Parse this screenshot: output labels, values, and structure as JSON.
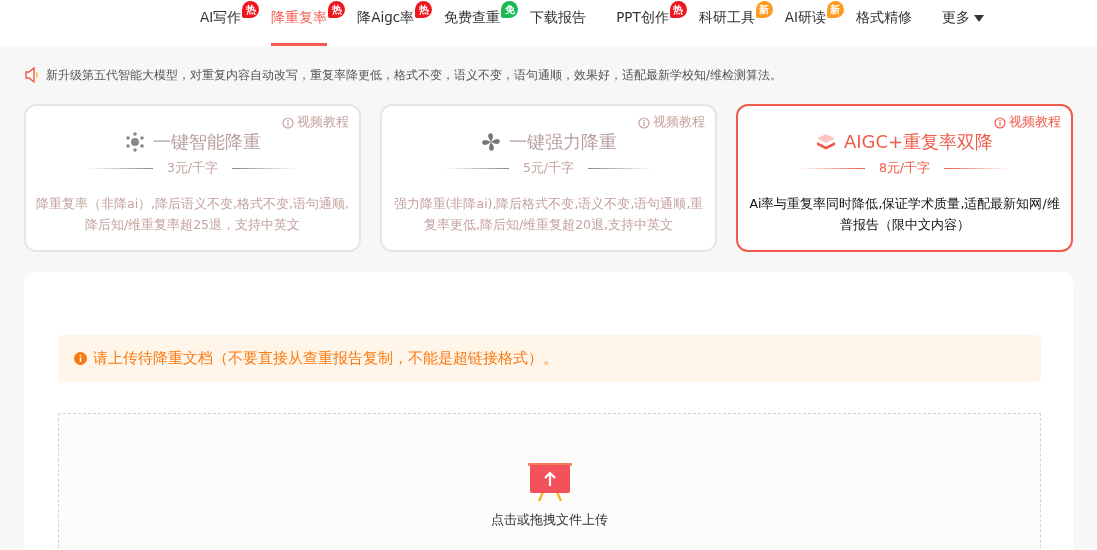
{
  "nav": [
    {
      "label": "AI写作",
      "selected": false,
      "badge": {
        "text": "热",
        "kind": "hot"
      }
    },
    {
      "label": "降重复率",
      "selected": true,
      "badge": {
        "text": "热",
        "kind": "hot"
      }
    },
    {
      "label": "降Aigc率",
      "selected": false,
      "badge": {
        "text": "热",
        "kind": "hot"
      }
    },
    {
      "label": "免费查重",
      "selected": false,
      "badge": {
        "text": "免",
        "kind": "free"
      }
    },
    {
      "label": "下载报告",
      "selected": false
    },
    {
      "label": "PPT创作",
      "selected": false,
      "badge": {
        "text": "热",
        "kind": "hot"
      }
    },
    {
      "label": "科研工具",
      "selected": false,
      "badge": {
        "text": "新",
        "kind": "new"
      }
    },
    {
      "label": "AI研读",
      "selected": false,
      "badge": {
        "text": "新",
        "kind": "new"
      }
    },
    {
      "label": "格式精修",
      "selected": false
    },
    {
      "label": "更多",
      "selected": false,
      "dropdown": true
    }
  ],
  "notice": "新升级第五代智能大模型，对重复内容自动改写，重复率降更低，格式不变，语义不变，语句通顺，效果好，适配最新学校知/维检测算法。",
  "plans": [
    {
      "title": "一键智能降重",
      "price": "3元/千字",
      "tutorial": "视频教程",
      "description": "降重复率（非降ai）,降后语义不变,格式不变,语句通顺,降后知/维重复率超25退，支持中英文",
      "selected": false
    },
    {
      "title": "一键强力降重",
      "price": "5元/千字",
      "tutorial": "视频教程",
      "description": "强力降重(非降ai),降后格式不变,语义不变,语句通顺,重复率更低,降后知/维重复超20退,支持中英文",
      "selected": false
    },
    {
      "title": "AIGC+重复率双降",
      "price": "8元/千字",
      "tutorial": "视频教程",
      "description": "Ai率与重复率同时降低,保证学术质量,适配最新知网/维普报告（限中文内容）",
      "selected": true
    }
  ],
  "upload": {
    "warning": "请上传待降重文档（不要直接从查重报告复制，不能是超链接格式）。",
    "prompt": "点击或拖拽文件上传"
  }
}
